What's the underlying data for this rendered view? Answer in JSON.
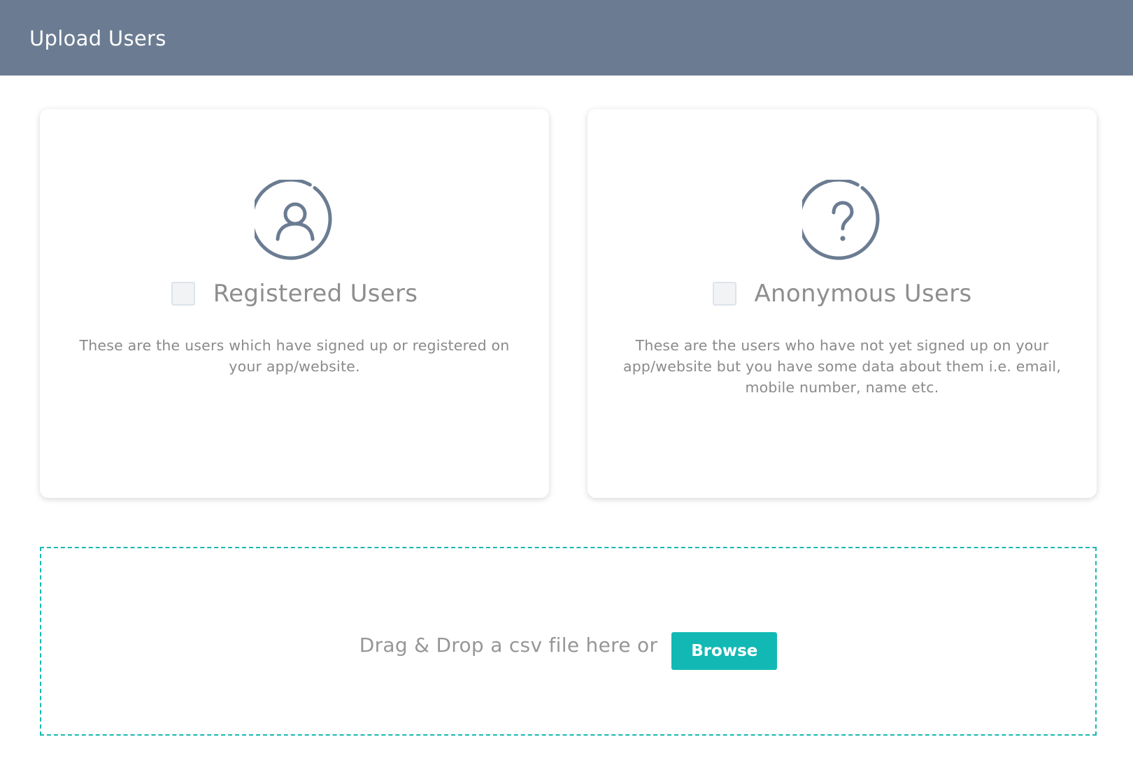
{
  "header": {
    "title": "Upload Users",
    "background_color": "#6b7c92"
  },
  "cards": [
    {
      "icon": "user-circle-icon",
      "title": "Registered Users",
      "checked": false,
      "description": "These are the users which have signed up or registered on your app/website."
    },
    {
      "icon": "question-circle-icon",
      "title": "Anonymous Users",
      "checked": false,
      "description": "These are the users who have not yet signed up on your app/website but you have some data about them i.e. email, mobile number, name etc."
    }
  ],
  "dropzone": {
    "text": "Drag & Drop a csv file here or",
    "browse_label": "Browse",
    "accent_color": "#12b9b4"
  },
  "colors": {
    "icon_stroke": "#6b7c92",
    "muted_text": "#8e8e8e"
  }
}
